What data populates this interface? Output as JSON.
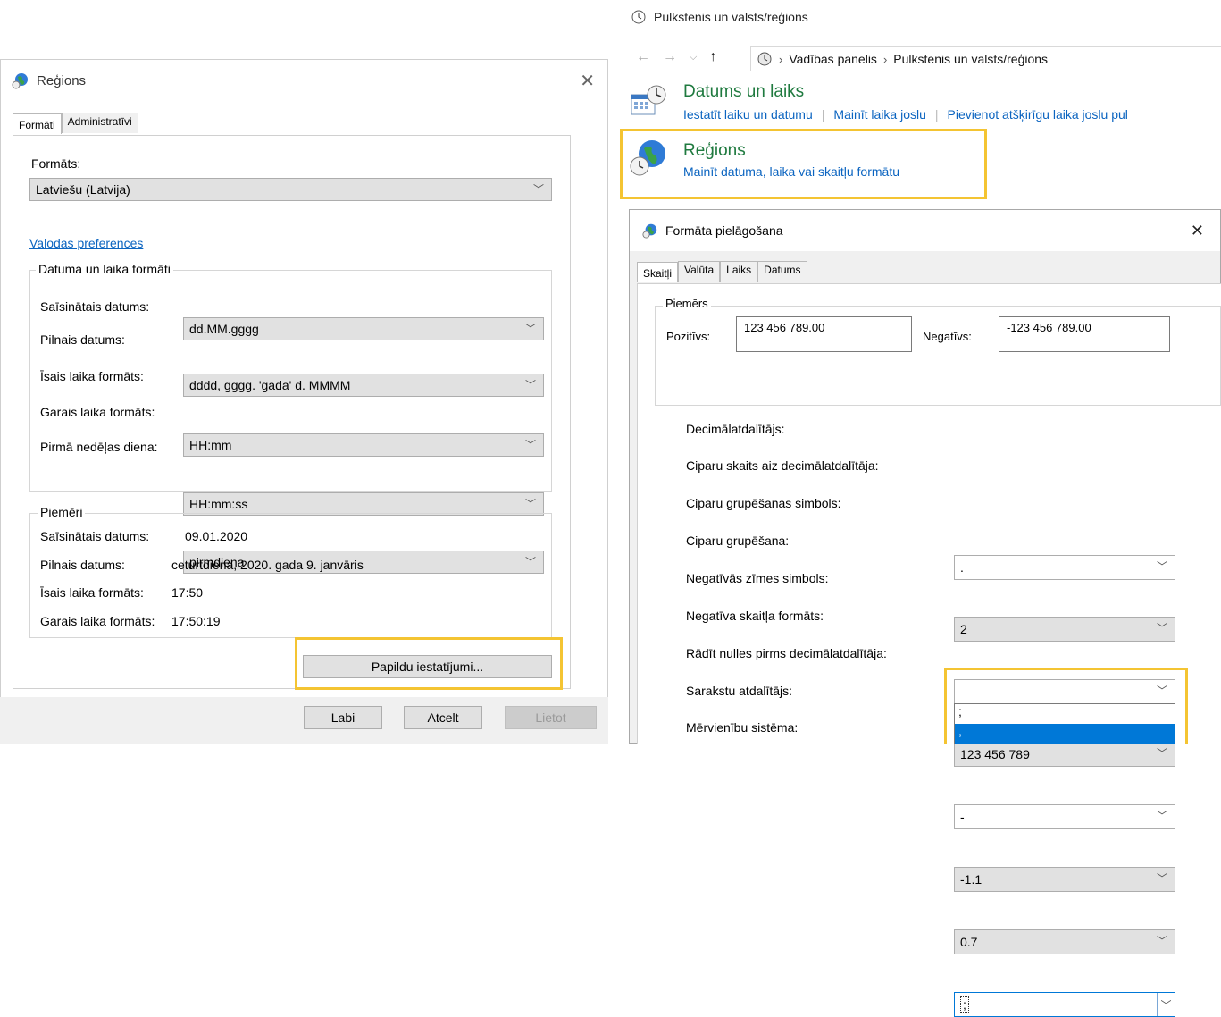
{
  "control_panel": {
    "window_title": "Pulkstenis un valsts/reģions",
    "breadcrumb": [
      "Vadības panelis",
      "Pulkstenis un valsts/reģions"
    ],
    "sections": [
      {
        "title": "Datums un laiks",
        "links": [
          "Iestatīt laiku un datumu",
          "Mainīt laika joslu",
          "Pievienot atšķirīgu laika joslu pul"
        ]
      },
      {
        "title": "Reģions",
        "links": [
          "Mainīt datuma, laika vai skaitļu formātu"
        ]
      }
    ]
  },
  "region_dialog": {
    "title": "Reģions",
    "tabs": [
      "Formāti",
      "Administratīvi"
    ],
    "format_label": "Formāts:",
    "format_value": "Latviešu (Latvija)",
    "language_link": "Valodas preferences",
    "date_time_group": "Datuma un laika formāti",
    "fields": [
      {
        "label": "Saīsinātais datums:",
        "value": "dd.MM.gggg"
      },
      {
        "label": "Pilnais datums:",
        "value": "dddd, gggg. 'gada' d. MMMM"
      },
      {
        "label": "Īsais laika formāts:",
        "value": "HH:mm"
      },
      {
        "label": "Garais laika formāts:",
        "value": "HH:mm:ss"
      },
      {
        "label": "Pirmā nedēļas diena:",
        "value": "pirmdiena"
      }
    ],
    "examples_group": "Piemēri",
    "examples": [
      {
        "label": "Saīsinātais datums:",
        "value": "09.01.2020"
      },
      {
        "label": "Pilnais datums:",
        "value": "ceturtdiena, 2020. gada 9. janvāris"
      },
      {
        "label": "Īsais laika formāts:",
        "value": "17:50"
      },
      {
        "label": "Garais laika formāts:",
        "value": "17:50:19"
      }
    ],
    "additional_settings": "Papildu iestatījumi...",
    "ok": "Labi",
    "cancel": "Atcelt",
    "apply": "Lietot"
  },
  "customize_dialog": {
    "title": "Formāta pielāgošana",
    "tabs": [
      "Skaitļi",
      "Valūta",
      "Laiks",
      "Datums"
    ],
    "sample_group": "Piemērs",
    "positive_label": "Pozitīvs:",
    "positive_value": "123 456 789.00",
    "negative_label": "Negatīvs:",
    "negative_value": "-123 456 789.00",
    "settings": [
      {
        "label": "Decimālatdalītājs:",
        "value": "."
      },
      {
        "label": "Ciparu skaits aiz decimālatdalītāja:",
        "value": "2"
      },
      {
        "label": "Ciparu grupēšanas simbols:",
        "value": ""
      },
      {
        "label": "Ciparu grupēšana:",
        "value": "123 456 789"
      },
      {
        "label": "Negatīvās zīmes simbols:",
        "value": "-"
      },
      {
        "label": "Negatīva skaitļa formāts:",
        "value": "-1.1"
      },
      {
        "label": "Rādīt nulles pirms decimālatdalītāja:",
        "value": "0.7"
      },
      {
        "label": "Sarakstu atdalītājs:",
        "value": ";"
      },
      {
        "label": "Mērvienību sistēma:",
        "value": ""
      }
    ],
    "list_separator_options": [
      ";",
      ","
    ]
  }
}
